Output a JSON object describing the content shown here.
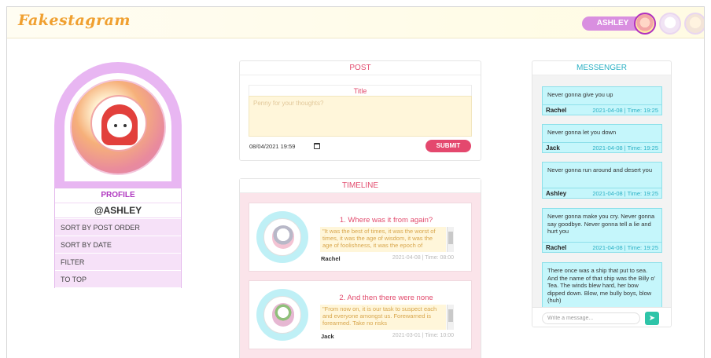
{
  "app": {
    "logo": "Fakestagram"
  },
  "header": {
    "username": "ASHLEY"
  },
  "profile": {
    "label": "PROFILE",
    "handle": "@ASHLEY",
    "menu": [
      "SORT BY POST ORDER",
      "SORT BY DATE",
      "FILTER",
      "TO TOP"
    ]
  },
  "post": {
    "heading": "POST",
    "title_label": "Title",
    "placeholder": "Penny for your thoughts?",
    "date_value": "08/04/2021 19:59",
    "submit_label": "SUBMIT"
  },
  "timeline": {
    "heading": "TIMELINE",
    "posts": [
      {
        "title": "1. Where was it from again?",
        "text": "\"It was the best of times, it was the worst of times, it was the age of wisdom, it was the age of foolishness, it was the epoch of",
        "author": "Rachel",
        "time": "2021-04-08 | Time: 08:00"
      },
      {
        "title": "2. And then there were none",
        "text": "\"From now on, it is our task to suspect each and everyone amongst us. Forewarned is forearmed. Take no risks",
        "author": "Jack",
        "time": "2021-03-01 | Time: 10:00"
      }
    ]
  },
  "messenger": {
    "heading": "MESSENGER",
    "messages": [
      {
        "text": "Never gonna give you up",
        "author": "Rachel",
        "time": "2021-04-08 | Time: 19:25"
      },
      {
        "text": "Never gonna let you down",
        "author": "Jack",
        "time": "2021-04-08 | Time: 19:25"
      },
      {
        "text": "Never gonna run around and desert you",
        "author": "Ashley",
        "time": "2021-04-08 | Time: 19:25"
      },
      {
        "text": "Never gonna make you cry. Never gonna say goodbye. Never gonna tell a lie and hurt you",
        "author": "Rachel",
        "time": "2021-04-08 | Time: 19:25"
      },
      {
        "text": "There once was a ship that put to sea. And the name of that ship was the Billy o' Tea. The winds blew hard, her bow dipped down. Blow, me bully boys, blow (huh)",
        "author": "",
        "time": ""
      }
    ],
    "input_placeholder": "Write a message...",
    "send_icon": "send-icon"
  },
  "colors": {
    "accent_pink": "#e4486e",
    "profile_lilac": "#e8b6f2",
    "messenger_cyan": "#c5f6fb",
    "logo_orange": "#f0a030"
  }
}
